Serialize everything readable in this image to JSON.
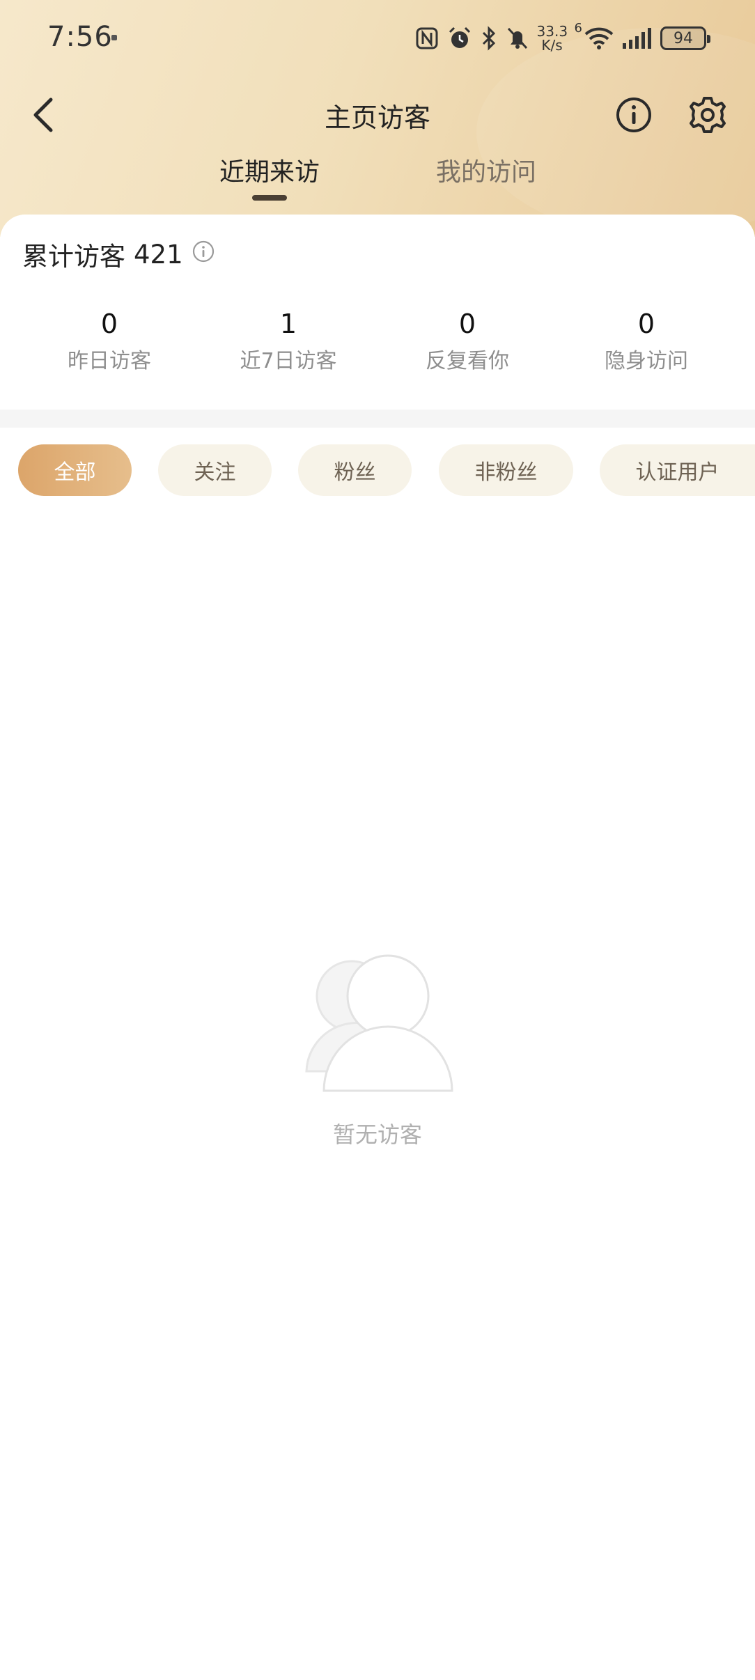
{
  "status_bar": {
    "time": "7:56",
    "net_speed_value": "33.3",
    "net_speed_unit": "K/s",
    "signal_type": "6",
    "battery": "94"
  },
  "header": {
    "title": "主页访客",
    "tabs": [
      {
        "label": "近期来访",
        "active": true
      },
      {
        "label": "我的访问",
        "active": false
      }
    ]
  },
  "summary": {
    "total_label": "累计访客",
    "total_value": "421"
  },
  "stats": [
    {
      "value": "0",
      "label": "昨日访客"
    },
    {
      "value": "1",
      "label": "近7日访客"
    },
    {
      "value": "0",
      "label": "反复看你"
    },
    {
      "value": "0",
      "label": "隐身访问"
    }
  ],
  "filters": [
    {
      "label": "全部",
      "active": true
    },
    {
      "label": "关注",
      "active": false
    },
    {
      "label": "粉丝",
      "active": false
    },
    {
      "label": "非粉丝",
      "active": false
    },
    {
      "label": "认证用户",
      "active": false
    }
  ],
  "empty_state": {
    "text": "暂无访客",
    "icon": "users-placeholder-icon"
  },
  "colors": {
    "header_gradient_start": "#f6e8cb",
    "header_gradient_end": "#e8c998",
    "accent": "#dca56a",
    "chip_bg": "#f7f3e8"
  }
}
